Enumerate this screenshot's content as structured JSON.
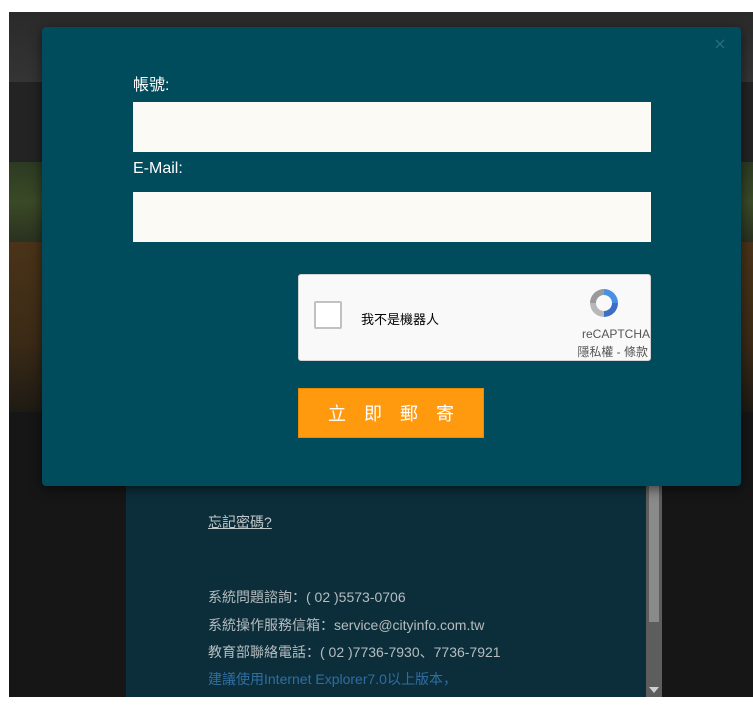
{
  "modal": {
    "close_icon": "close-icon",
    "account_label": "帳號:",
    "account_value": "",
    "email_label": "E-Mail:",
    "email_value": "",
    "captcha": {
      "checkbox_label": "我不是機器人",
      "brand": "reCAPTCHA",
      "terms": "隱私權 - 條款",
      "checked": false
    },
    "submit_label": "立即郵寄"
  },
  "background_panel": {
    "forgot_password": "忘記密碼?",
    "info_lines": [
      "系統問題諮詢：( 02 )5573-0706",
      "系統操作服務信箱：service@cityinfo.com.tw",
      "教育部聯絡電話：( 02 )7736-7930、7736-7921",
      "建議使用Internet Explorer7.0以上版本，"
    ]
  },
  "colors": {
    "modal_bg": "#004b5c",
    "submit_bg": "#ff9a0f",
    "input_bg": "#fbfaf4"
  }
}
